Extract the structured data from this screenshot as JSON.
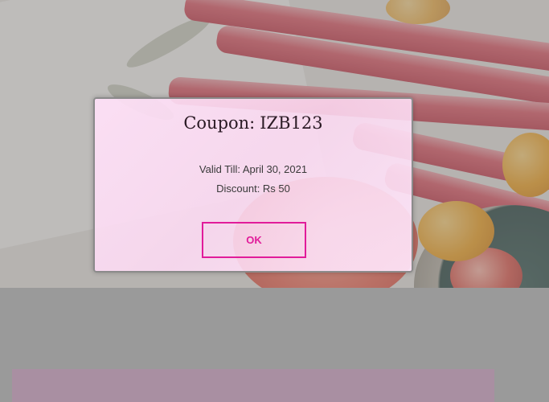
{
  "coupon": {
    "title_prefix": "Coupon:",
    "code": "IZB123",
    "valid_till": "Valid Till: April 30, 2021",
    "discount": "Discount: Rs 50",
    "ok_label": "OK"
  },
  "colors": {
    "accent": "#e11c9a",
    "dialog_background": "#fde4f7",
    "scrim": "#9a9a9a",
    "bottom_bar": "#a98fa2"
  }
}
